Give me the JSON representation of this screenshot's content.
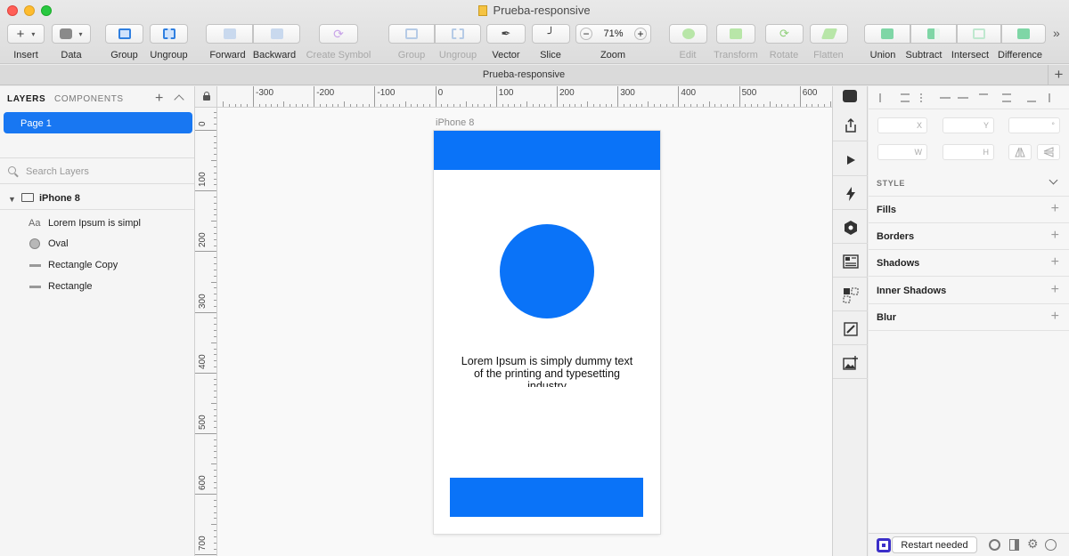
{
  "window": {
    "title": "Prueba-responsive"
  },
  "document_tab": {
    "name": "Prueba-responsive"
  },
  "toolbar": {
    "items": [
      {
        "label": "Insert",
        "enabled": true
      },
      {
        "label": "Data",
        "enabled": true
      },
      {
        "label": "Group",
        "enabled": true
      },
      {
        "label": "Ungroup",
        "enabled": true
      },
      {
        "label": "Forward",
        "enabled": true
      },
      {
        "label": "Backward",
        "enabled": true
      },
      {
        "label": "Create Symbol",
        "enabled": false
      },
      {
        "label": "Group",
        "enabled": false
      },
      {
        "label": "Ungroup",
        "enabled": false
      },
      {
        "label": "Vector",
        "enabled": true
      },
      {
        "label": "Slice",
        "enabled": true
      },
      {
        "label": "Zoom",
        "enabled": true
      },
      {
        "label": "Edit",
        "enabled": false
      },
      {
        "label": "Transform",
        "enabled": false
      },
      {
        "label": "Rotate",
        "enabled": false
      },
      {
        "label": "Flatten",
        "enabled": false
      },
      {
        "label": "Union",
        "enabled": true
      },
      {
        "label": "Subtract",
        "enabled": true
      },
      {
        "label": "Intersect",
        "enabled": true
      },
      {
        "label": "Difference",
        "enabled": true
      }
    ],
    "zoom_value": "71%",
    "zoom_minus": "−",
    "zoom_plus": "+",
    "insert_symbol": "+",
    "overflow_symbol": "»"
  },
  "layers_panel": {
    "tab_layers": "LAYERS",
    "tab_components": "COMPONENTS",
    "add_symbol": "+",
    "pages": [
      {
        "name": "Page 1",
        "selected": true
      }
    ],
    "search_placeholder": "Search Layers",
    "artboard": {
      "name": "iPhone 8",
      "icon": "artboard-icon"
    },
    "layers": [
      {
        "name": "Lorem Ipsum is simpl",
        "icon": "text-layer-icon",
        "icon_text": "Aa"
      },
      {
        "name": "Oval",
        "icon": "oval-layer-icon"
      },
      {
        "name": "Rectangle Copy",
        "icon": "rectangle-layer-icon"
      },
      {
        "name": "Rectangle",
        "icon": "rectangle-layer-icon"
      }
    ]
  },
  "rulers": {
    "horizontal_labels": [
      "-300",
      "-200",
      "-100",
      "0",
      "100",
      "200",
      "300",
      "400",
      "500",
      "600"
    ],
    "vertical_labels": [
      "0",
      "100",
      "200",
      "300",
      "400",
      "500",
      "600",
      "700"
    ]
  },
  "canvas": {
    "artboard_name": "iPhone 8",
    "body_text": "Lorem Ipsum is simply dummy text of the printing and typesetting industry",
    "accent_color": "#0a73f8"
  },
  "vertical_tools": [
    "export-icon",
    "preview-icon",
    "prototype-icon",
    "plugin-icon",
    "layout-icon",
    "selection-icon",
    "edit-icon",
    "image-icon"
  ],
  "inspector": {
    "fields": {
      "x": "X",
      "y": "Y",
      "rotation": "°",
      "w": "W",
      "h": "H"
    },
    "style_header": "STYLE",
    "sections": [
      "Fills",
      "Borders",
      "Shadows",
      "Inner Shadows",
      "Blur"
    ],
    "add_symbol": "+"
  },
  "status": {
    "restart_label": "Restart needed"
  },
  "colors": {
    "accent": "#0a73f8",
    "selection": "#1877f2"
  }
}
